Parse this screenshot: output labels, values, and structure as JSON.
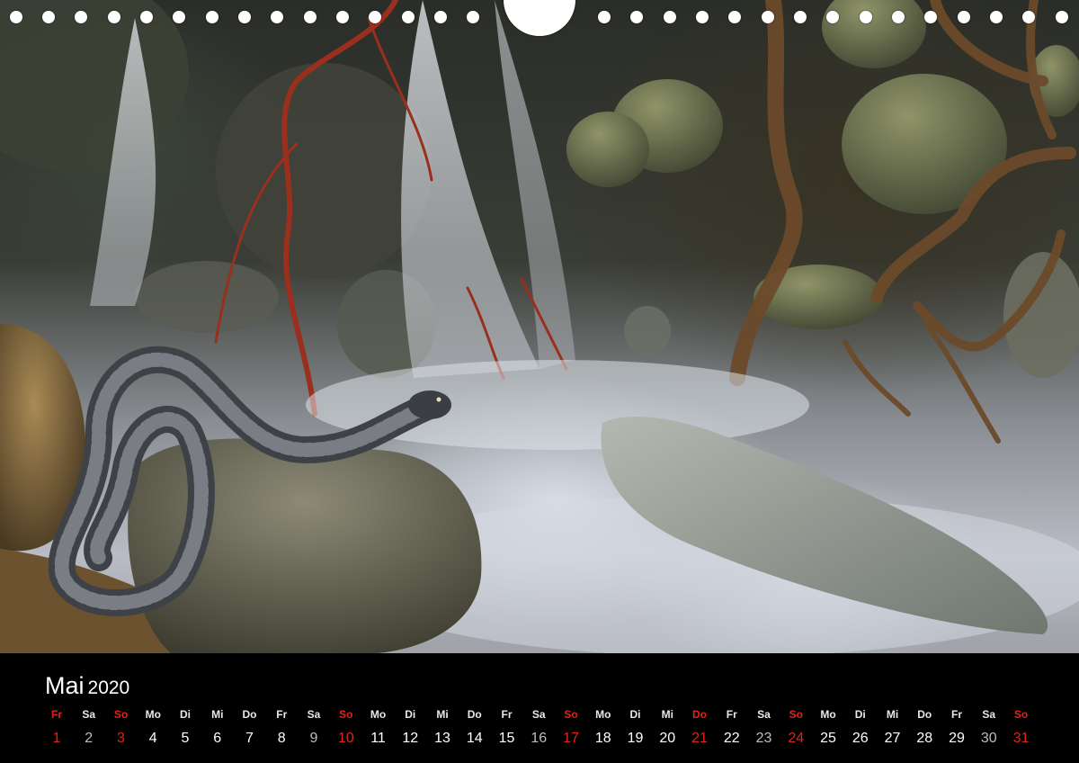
{
  "calendar": {
    "month": "Mai",
    "year": "2020",
    "days": [
      {
        "dn": "Fr",
        "num": "1",
        "type": "red"
      },
      {
        "dn": "Sa",
        "num": "2",
        "type": "sat"
      },
      {
        "dn": "So",
        "num": "3",
        "type": "red"
      },
      {
        "dn": "Mo",
        "num": "4",
        "type": "norm"
      },
      {
        "dn": "Di",
        "num": "5",
        "type": "norm"
      },
      {
        "dn": "Mi",
        "num": "6",
        "type": "norm"
      },
      {
        "dn": "Do",
        "num": "7",
        "type": "norm"
      },
      {
        "dn": "Fr",
        "num": "8",
        "type": "norm"
      },
      {
        "dn": "Sa",
        "num": "9",
        "type": "sat"
      },
      {
        "dn": "So",
        "num": "10",
        "type": "red"
      },
      {
        "dn": "Mo",
        "num": "11",
        "type": "norm"
      },
      {
        "dn": "Di",
        "num": "12",
        "type": "norm"
      },
      {
        "dn": "Mi",
        "num": "13",
        "type": "norm"
      },
      {
        "dn": "Do",
        "num": "14",
        "type": "norm"
      },
      {
        "dn": "Fr",
        "num": "15",
        "type": "norm"
      },
      {
        "dn": "Sa",
        "num": "16",
        "type": "sat"
      },
      {
        "dn": "So",
        "num": "17",
        "type": "red"
      },
      {
        "dn": "Mo",
        "num": "18",
        "type": "norm"
      },
      {
        "dn": "Di",
        "num": "19",
        "type": "norm"
      },
      {
        "dn": "Mi",
        "num": "20",
        "type": "norm"
      },
      {
        "dn": "Do",
        "num": "21",
        "type": "red"
      },
      {
        "dn": "Fr",
        "num": "22",
        "type": "norm"
      },
      {
        "dn": "Sa",
        "num": "23",
        "type": "sat"
      },
      {
        "dn": "So",
        "num": "24",
        "type": "red"
      },
      {
        "dn": "Mo",
        "num": "25",
        "type": "norm"
      },
      {
        "dn": "Di",
        "num": "26",
        "type": "norm"
      },
      {
        "dn": "Mi",
        "num": "27",
        "type": "norm"
      },
      {
        "dn": "Do",
        "num": "28",
        "type": "norm"
      },
      {
        "dn": "Fr",
        "num": "29",
        "type": "norm"
      },
      {
        "dn": "Sa",
        "num": "30",
        "type": "sat"
      },
      {
        "dn": "So",
        "num": "31",
        "type": "red"
      }
    ]
  },
  "colors": {
    "holiday_red": "#e2231a",
    "background": "#000000",
    "text": "#ffffff"
  },
  "photo": {
    "subject": "snake-icon"
  }
}
